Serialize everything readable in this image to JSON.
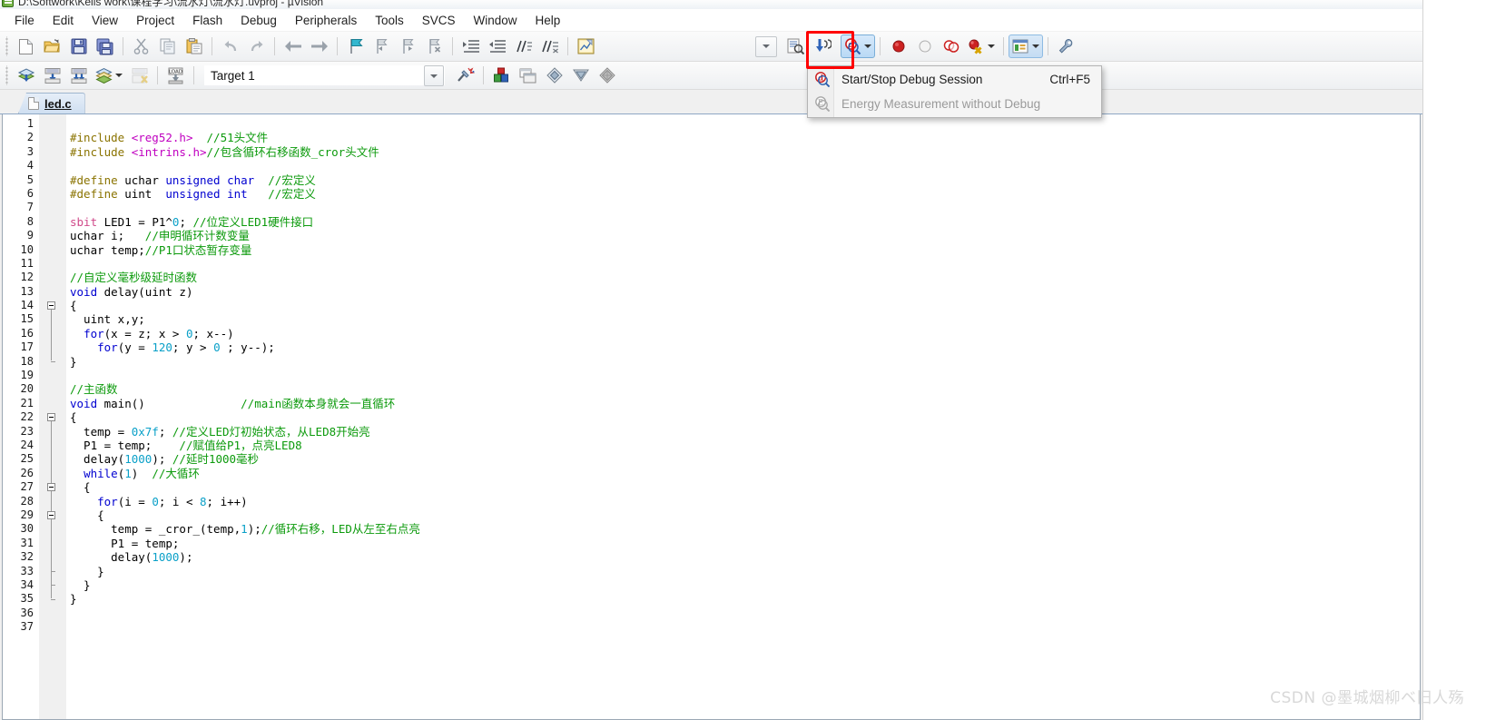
{
  "window": {
    "title": "D:\\Softwork\\Keils work\\课程学习\\流水灯\\流水灯.uvproj - µVision",
    "app_icon": "uvision-icon"
  },
  "menubar": {
    "items": [
      {
        "label": "File"
      },
      {
        "label": "Edit"
      },
      {
        "label": "View"
      },
      {
        "label": "Project"
      },
      {
        "label": "Flash"
      },
      {
        "label": "Debug"
      },
      {
        "label": "Peripherals"
      },
      {
        "label": "Tools"
      },
      {
        "label": "SVCS"
      },
      {
        "label": "Window"
      },
      {
        "label": "Help"
      }
    ]
  },
  "toolbar_main": {
    "buttons": [
      {
        "name": "new-file-icon",
        "title": "New"
      },
      {
        "name": "open-file-icon",
        "title": "Open"
      },
      {
        "name": "save-icon",
        "title": "Save"
      },
      {
        "name": "save-all-icon",
        "title": "Save All"
      },
      {
        "name": "cut-icon",
        "title": "Cut"
      },
      {
        "name": "copy-icon",
        "title": "Copy"
      },
      {
        "name": "paste-icon",
        "title": "Paste"
      },
      {
        "name": "undo-icon",
        "title": "Undo"
      },
      {
        "name": "redo-icon",
        "title": "Redo"
      },
      {
        "name": "navigate-back-icon",
        "title": "Back"
      },
      {
        "name": "navigate-forward-icon",
        "title": "Forward"
      },
      {
        "name": "insert-bookmark-icon",
        "title": "Insert/Remove Bookmark"
      },
      {
        "name": "prev-bookmark-icon",
        "title": "Previous Bookmark"
      },
      {
        "name": "next-bookmark-icon",
        "title": "Next Bookmark"
      },
      {
        "name": "clear-bookmarks-icon",
        "title": "Clear All Bookmarks"
      },
      {
        "name": "indent-icon",
        "title": "Indent"
      },
      {
        "name": "outdent-icon",
        "title": "Outdent"
      },
      {
        "name": "comment-icon",
        "title": "Comment"
      },
      {
        "name": "uncomment-icon",
        "title": "Uncomment"
      },
      {
        "name": "configure-icon",
        "title": "Configuration Wizard"
      }
    ],
    "find_combo_value": "",
    "debug_button": {
      "name": "start-stop-debug-icon",
      "highlighted": true
    },
    "breakpoint_buttons": [
      {
        "name": "insert-breakpoint-icon"
      },
      {
        "name": "disable-breakpoint-icon"
      },
      {
        "name": "disable-all-breakpoints-icon"
      },
      {
        "name": "kill-all-breakpoints-icon"
      }
    ],
    "window_button": {
      "name": "manage-windows-icon"
    },
    "settings_button": {
      "name": "configure-tools-icon"
    }
  },
  "toolbar_build": {
    "buttons": [
      {
        "name": "translate-icon"
      },
      {
        "name": "build-target-icon"
      },
      {
        "name": "rebuild-all-icon"
      },
      {
        "name": "batch-build-icon"
      },
      {
        "name": "stop-build-icon"
      },
      {
        "name": "download-icon"
      }
    ],
    "target_label": "Target 1",
    "right_buttons": [
      {
        "name": "target-options-icon"
      },
      {
        "name": "manage-project-items-icon"
      },
      {
        "name": "project-windows-icon"
      },
      {
        "name": "books-window-icon"
      },
      {
        "name": "functions-window-icon"
      },
      {
        "name": "templates-window-icon"
      }
    ]
  },
  "dropdown": {
    "visible": true,
    "items": [
      {
        "icon": "start-stop-debug-icon",
        "label": "Start/Stop Debug Session",
        "shortcut": "Ctrl+F5",
        "enabled": true
      },
      {
        "icon": "energy-measurement-icon",
        "label": "Energy Measurement without Debug",
        "shortcut": "",
        "enabled": false
      }
    ]
  },
  "tabs": [
    {
      "label": "led.c",
      "icon": "document-icon",
      "active": true
    }
  ],
  "editor": {
    "first_line": 1,
    "lines": [
      {
        "n": 1,
        "tokens": []
      },
      {
        "n": 2,
        "tokens": [
          {
            "t": "#include ",
            "c": "pp"
          },
          {
            "t": "<reg52.h>",
            "c": "hd"
          },
          {
            "t": "  ",
            "c": "op"
          },
          {
            "t": "//51头文件",
            "c": "cm"
          }
        ]
      },
      {
        "n": 3,
        "tokens": [
          {
            "t": "#include ",
            "c": "pp"
          },
          {
            "t": "<intrins.h>",
            "c": "hd"
          },
          {
            "t": "//包含循环右移函数_cror头文件",
            "c": "cm"
          }
        ]
      },
      {
        "n": 4,
        "tokens": []
      },
      {
        "n": 5,
        "tokens": [
          {
            "t": "#define ",
            "c": "pp"
          },
          {
            "t": "uchar ",
            "c": "op"
          },
          {
            "t": "unsigned char",
            "c": "k"
          },
          {
            "t": "  ",
            "c": "op"
          },
          {
            "t": "//宏定义",
            "c": "cm"
          }
        ]
      },
      {
        "n": 6,
        "tokens": [
          {
            "t": "#define ",
            "c": "pp"
          },
          {
            "t": "uint  ",
            "c": "op"
          },
          {
            "t": "unsigned int",
            "c": "k"
          },
          {
            "t": "   ",
            "c": "op"
          },
          {
            "t": "//宏定义",
            "c": "cm"
          }
        ]
      },
      {
        "n": 7,
        "tokens": []
      },
      {
        "n": 8,
        "tokens": [
          {
            "t": "sbit",
            "c": "sb"
          },
          {
            "t": " LED1 = P1^",
            "c": "op"
          },
          {
            "t": "0",
            "c": "nu"
          },
          {
            "t": "; ",
            "c": "op"
          },
          {
            "t": "//位定义LED1硬件接口",
            "c": "cm"
          }
        ]
      },
      {
        "n": 9,
        "tokens": [
          {
            "t": "uchar i;   ",
            "c": "op"
          },
          {
            "t": "//申明循环计数变量",
            "c": "cm"
          }
        ]
      },
      {
        "n": 10,
        "tokens": [
          {
            "t": "uchar temp;",
            "c": "op"
          },
          {
            "t": "//P1口状态暂存变量",
            "c": "cm"
          }
        ]
      },
      {
        "n": 11,
        "tokens": []
      },
      {
        "n": 12,
        "tokens": [
          {
            "t": "//自定义毫秒级延时函数",
            "c": "cm"
          }
        ]
      },
      {
        "n": 13,
        "tokens": [
          {
            "t": "void",
            "c": "k"
          },
          {
            "t": " delay(uint z)",
            "c": "op"
          }
        ]
      },
      {
        "n": 14,
        "tokens": [
          {
            "t": "{",
            "c": "op"
          }
        ]
      },
      {
        "n": 15,
        "tokens": [
          {
            "t": "  uint x,y;",
            "c": "op"
          }
        ]
      },
      {
        "n": 16,
        "tokens": [
          {
            "t": "  ",
            "c": "op"
          },
          {
            "t": "for",
            "c": "k"
          },
          {
            "t": "(x = z; x > ",
            "c": "op"
          },
          {
            "t": "0",
            "c": "nu"
          },
          {
            "t": "; x--)",
            "c": "op"
          }
        ]
      },
      {
        "n": 17,
        "tokens": [
          {
            "t": "    ",
            "c": "op"
          },
          {
            "t": "for",
            "c": "k"
          },
          {
            "t": "(y = ",
            "c": "op"
          },
          {
            "t": "120",
            "c": "nu"
          },
          {
            "t": "; y > ",
            "c": "op"
          },
          {
            "t": "0",
            "c": "nu"
          },
          {
            "t": " ; y--);",
            "c": "op"
          }
        ]
      },
      {
        "n": 18,
        "tokens": [
          {
            "t": "}",
            "c": "op"
          }
        ]
      },
      {
        "n": 19,
        "tokens": []
      },
      {
        "n": 20,
        "tokens": [
          {
            "t": "//主函数",
            "c": "cm"
          }
        ]
      },
      {
        "n": 21,
        "tokens": [
          {
            "t": "void",
            "c": "k"
          },
          {
            "t": " main()              ",
            "c": "op"
          },
          {
            "t": "//main函数本身就会一直循环",
            "c": "cm"
          }
        ]
      },
      {
        "n": 22,
        "tokens": [
          {
            "t": "{",
            "c": "op"
          }
        ]
      },
      {
        "n": 23,
        "tokens": [
          {
            "t": "  temp = ",
            "c": "op"
          },
          {
            "t": "0x7f",
            "c": "nu"
          },
          {
            "t": "; ",
            "c": "op"
          },
          {
            "t": "//定义LED灯初始状态，从LED8开始亮",
            "c": "cm"
          }
        ]
      },
      {
        "n": 24,
        "tokens": [
          {
            "t": "  P1 = temp;    ",
            "c": "op"
          },
          {
            "t": "//赋值给P1，点亮LED8",
            "c": "cm"
          }
        ]
      },
      {
        "n": 25,
        "tokens": [
          {
            "t": "  delay(",
            "c": "op"
          },
          {
            "t": "1000",
            "c": "nu"
          },
          {
            "t": "); ",
            "c": "op"
          },
          {
            "t": "//延时1000毫秒",
            "c": "cm"
          }
        ]
      },
      {
        "n": 26,
        "tokens": [
          {
            "t": "  ",
            "c": "op"
          },
          {
            "t": "while",
            "c": "k"
          },
          {
            "t": "(",
            "c": "op"
          },
          {
            "t": "1",
            "c": "nu"
          },
          {
            "t": ")  ",
            "c": "op"
          },
          {
            "t": "//大循环",
            "c": "cm"
          }
        ]
      },
      {
        "n": 27,
        "tokens": [
          {
            "t": "  {",
            "c": "op"
          }
        ]
      },
      {
        "n": 28,
        "tokens": [
          {
            "t": "    ",
            "c": "op"
          },
          {
            "t": "for",
            "c": "k"
          },
          {
            "t": "(i = ",
            "c": "op"
          },
          {
            "t": "0",
            "c": "nu"
          },
          {
            "t": "; i < ",
            "c": "op"
          },
          {
            "t": "8",
            "c": "nu"
          },
          {
            "t": "; i++)",
            "c": "op"
          }
        ]
      },
      {
        "n": 29,
        "tokens": [
          {
            "t": "    {",
            "c": "op"
          }
        ]
      },
      {
        "n": 30,
        "tokens": [
          {
            "t": "      temp = _cror_(temp,",
            "c": "op"
          },
          {
            "t": "1",
            "c": "nu"
          },
          {
            "t": ");",
            "c": "op"
          },
          {
            "t": "//循环右移，LED从左至右点亮",
            "c": "cm"
          }
        ]
      },
      {
        "n": 31,
        "tokens": [
          {
            "t": "      P1 = temp;",
            "c": "op"
          }
        ]
      },
      {
        "n": 32,
        "tokens": [
          {
            "t": "      delay(",
            "c": "op"
          },
          {
            "t": "1000",
            "c": "nu"
          },
          {
            "t": ");",
            "c": "op"
          }
        ]
      },
      {
        "n": 33,
        "tokens": [
          {
            "t": "    }",
            "c": "op"
          }
        ]
      },
      {
        "n": 34,
        "tokens": [
          {
            "t": "  }",
            "c": "op"
          }
        ]
      },
      {
        "n": 35,
        "tokens": [
          {
            "t": "}",
            "c": "op"
          }
        ]
      },
      {
        "n": 36,
        "tokens": []
      },
      {
        "n": 37,
        "tokens": []
      }
    ],
    "fold_markers": [
      14,
      22,
      27,
      29
    ]
  },
  "watermark": {
    "text": "CSDN @墨城烟柳ベ旧人殇"
  },
  "colors": {
    "accent": "#0a6cc0",
    "highlight_box": "#ff0000",
    "comment": "#0c9a0c",
    "keyword": "#0000d0",
    "number": "#0aa0c8",
    "preprocessor": "#8a7300",
    "header": "#c000c0"
  }
}
